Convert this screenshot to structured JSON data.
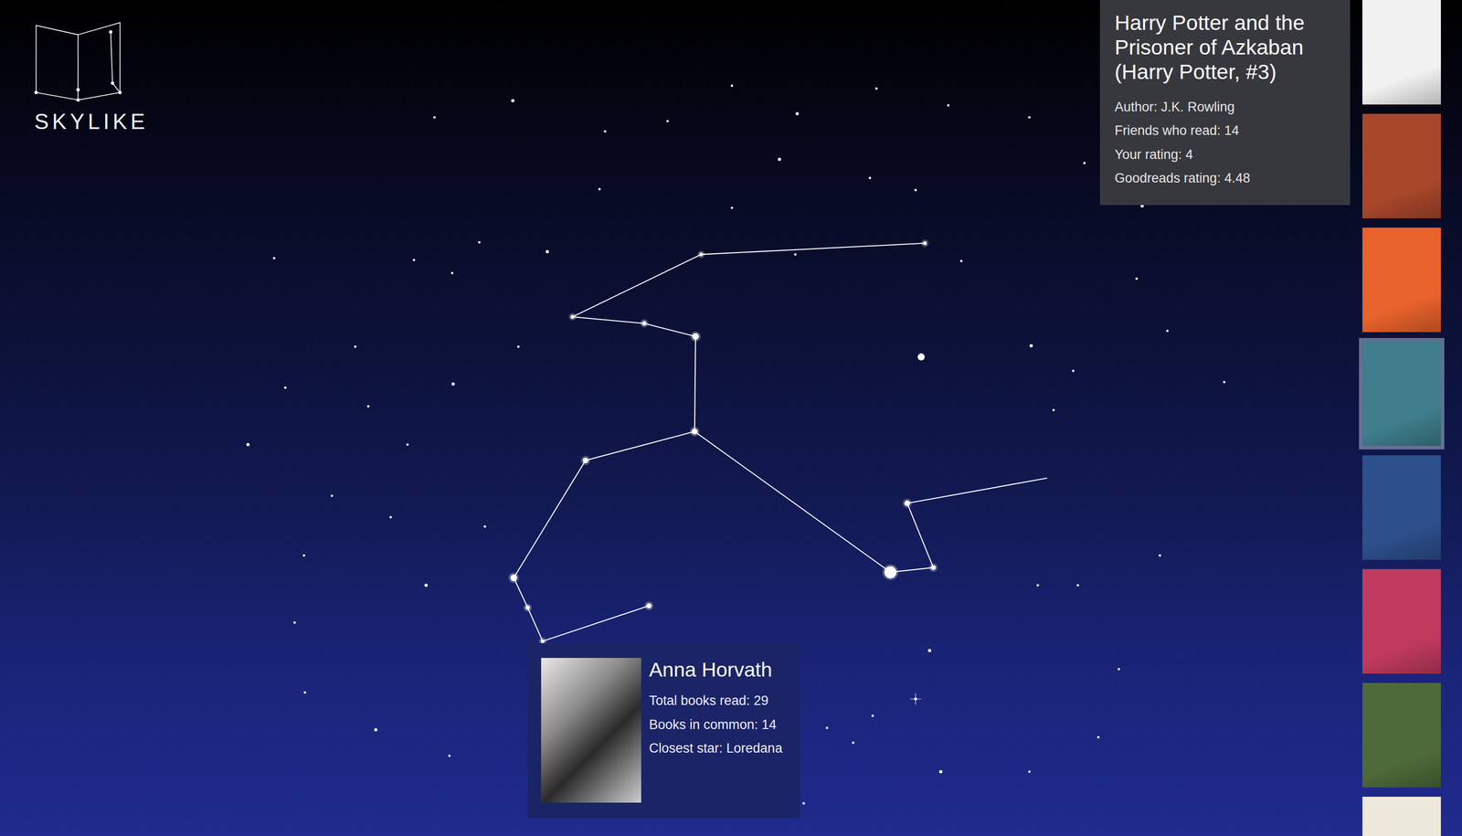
{
  "logo": {
    "text": "SKYLIKE"
  },
  "book_info": {
    "title": "Harry Potter and the Prisoner of Azkaban (Harry Potter, #3)",
    "lines": [
      "Author: J.K. Rowling",
      "Friends who read: 14",
      "Your rating: 4",
      "Goodreads rating: 4.48"
    ]
  },
  "books": [
    {
      "selected": false,
      "color": "#f1f1f1"
    },
    {
      "selected": false,
      "color": "#a9472b"
    },
    {
      "selected": false,
      "color": "#e8622b"
    },
    {
      "selected": true,
      "color": "#3f7e8c"
    },
    {
      "selected": false,
      "color": "#2d4f8c"
    },
    {
      "selected": false,
      "color": "#c03a5e"
    },
    {
      "selected": false,
      "color": "#4f6a3a"
    },
    {
      "selected": false,
      "color": "#ede8dc"
    }
  ],
  "friend_card": {
    "name": "Anna Horvath",
    "lines": [
      "Total books read: 29",
      "Books in common: 14",
      "Closest star: Loredana"
    ]
  }
}
